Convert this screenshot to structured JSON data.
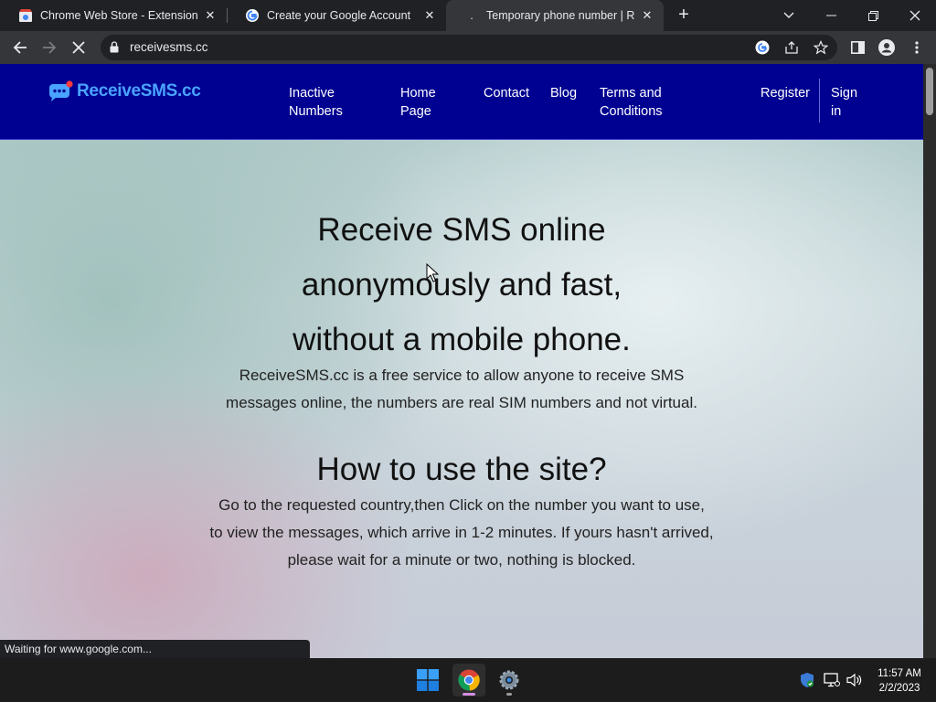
{
  "browser": {
    "tabs": [
      {
        "title": "Chrome Web Store - Extensions"
      },
      {
        "title": "Create your Google Account"
      },
      {
        "title": "Temporary phone number | Rece"
      }
    ],
    "url": "receivesms.cc",
    "status_text": "Waiting for www.google.com..."
  },
  "site": {
    "logo_text": "ReceiveSMS.cc",
    "nav": {
      "inactive_l1": "Inactive",
      "inactive_l2": "Numbers",
      "home_l1": "Home",
      "home_l2": "Page",
      "contact": "Contact",
      "blog": "Blog",
      "terms_l1": "Terms and",
      "terms_l2": "Conditions",
      "register": "Register",
      "signin_l1": "Sign",
      "signin_l2": "in"
    },
    "hero": {
      "line1": "Receive SMS online",
      "line2": "anonymously and fast,",
      "line3": "without a mobile phone.",
      "desc1": "ReceiveSMS.cc is a free service to allow anyone to receive SMS",
      "desc2": "messages online, the numbers are real SIM numbers and not virtual."
    },
    "howto": {
      "title": "How to use the site?",
      "p1": "Go to the requested country,then Click on the number you want to use,",
      "p2": "to view the messages, which arrive in 1-2 minutes. If yours hasn't arrived,",
      "p3": "please wait for a minute or two, nothing is blocked."
    }
  },
  "taskbar": {
    "time": "11:57 AM",
    "date": "2/2/2023"
  },
  "colors": {
    "nav_bg": "#000091",
    "logo_blue": "#4aa3ff",
    "chrome_dark": "#202124",
    "chrome_toolbar": "#35363a"
  }
}
